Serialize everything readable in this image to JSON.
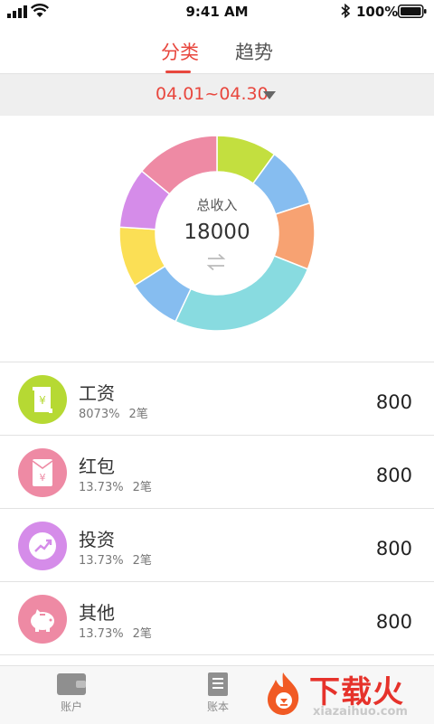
{
  "status_bar": {
    "time": "9:41 AM",
    "battery_percent": "100%"
  },
  "tabs": [
    {
      "label": "分类",
      "active": true
    },
    {
      "label": "趋势",
      "active": false
    }
  ],
  "date_filter": {
    "range": "04.01~04.30"
  },
  "summary": {
    "label": "总收入",
    "value": "18000"
  },
  "chart_data": {
    "type": "pie",
    "style": "donut",
    "center_label": "总收入",
    "center_value": 18000,
    "slices": [
      {
        "color": "#c3df3f",
        "share": 0.1
      },
      {
        "color": "#86bdf0",
        "share": 0.1
      },
      {
        "color": "#f7a272",
        "share": 0.11
      },
      {
        "color": "#88dbe0",
        "share": 0.26
      },
      {
        "color": "#86bdf0",
        "share": 0.09
      },
      {
        "color": "#fbdf55",
        "share": 0.1
      },
      {
        "color": "#d58ce9",
        "share": 0.1
      },
      {
        "color": "#ee8aa4",
        "share": 0.14
      }
    ]
  },
  "categories": [
    {
      "name": "工资",
      "percent": "8073%",
      "count": "2笔",
      "amount": "800",
      "icon": "salary-scroll-icon",
      "color": "#b6d933"
    },
    {
      "name": "红包",
      "percent": "13.73%",
      "count": "2笔",
      "amount": "800",
      "icon": "red-envelope-icon",
      "color": "#ee8aa4"
    },
    {
      "name": "投资",
      "percent": "13.73%",
      "count": "2笔",
      "amount": "800",
      "icon": "trend-up-icon",
      "color": "#d58ce9"
    },
    {
      "name": "其他",
      "percent": "13.73%",
      "count": "2笔",
      "amount": "800",
      "icon": "piggy-bank-icon",
      "color": "#ee8aa4"
    }
  ],
  "bottom_nav": [
    {
      "label": "账户",
      "icon": "wallet-icon"
    },
    {
      "label": "账本",
      "icon": "ledger-icon"
    }
  ],
  "watermark": {
    "text": "下载火",
    "subtext": "xiazaihuo.com"
  },
  "colors": {
    "accent": "#e8473e"
  }
}
